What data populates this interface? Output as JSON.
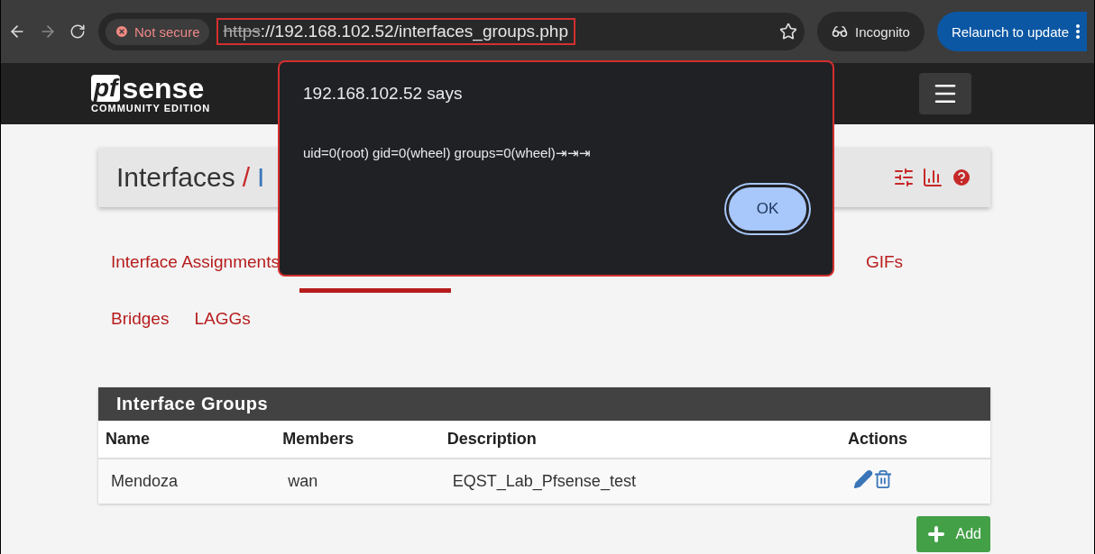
{
  "browser": {
    "security": "Not secure",
    "url_scheme": "https",
    "url_rest": "://192.168.102.52/interfaces_groups.php",
    "profile": "Incognito",
    "relaunch": "Relaunch to update"
  },
  "navbar": {
    "logo": "sense",
    "logo_mark": "pf",
    "edition": "COMMUNITY EDITION"
  },
  "breadcrumb": [
    "Interfaces",
    "I"
  ],
  "breadcrumb_separator": "/",
  "tabs": [
    {
      "label": "Interface Assignments",
      "selected": false
    },
    {
      "kind": "covered",
      "selected": true
    },
    {
      "label": "GIFs",
      "selected": false
    },
    {
      "label": "Bridges",
      "selected": false
    },
    {
      "label": "LAGGs",
      "selected": false
    }
  ],
  "panel": {
    "title": "Interface Groups",
    "columns": [
      "Name",
      "Members",
      "Description",
      "Actions"
    ],
    "rows": [
      {
        "name": "Mendoza",
        "members": "wan",
        "description": "EQST_Lab_Pfsense_test"
      }
    ]
  },
  "add_button": "Add",
  "dialog": {
    "title": "192.168.102.52 says",
    "message": "uid=0(root) gid=0(wheel) groups=0(wheel)⇥⇥⇥",
    "ok": "OK"
  }
}
